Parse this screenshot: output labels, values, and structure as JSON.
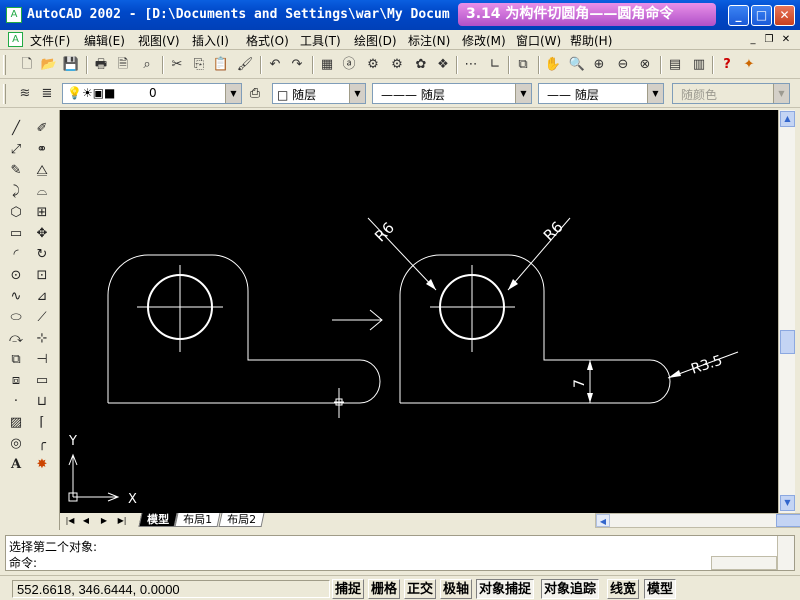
{
  "app": {
    "title": "AutoCAD 2002 - [D:\\Documents and Settings\\war\\My Docum",
    "banner": "3.14 为构件切圆角——圆角命令",
    "min_label": "_",
    "max_label": "□",
    "close_label": "✕"
  },
  "menu": {
    "items": [
      "文件(F)",
      "编辑(E)",
      "视图(V)",
      "插入(I)",
      "格式(O)",
      "工具(T)",
      "绘图(D)",
      "标注(N)",
      "修改(M)",
      "窗口(W)",
      "帮助(H)"
    ],
    "mdi_min": "_",
    "mdi_restore": "❐",
    "mdi_close": "✕"
  },
  "layers": {
    "current_layer": "0",
    "color": "□ 随层",
    "linetype": "——— 随层",
    "lineweight": "—— 随层",
    "plotstyle": "随颜色"
  },
  "drawing": {
    "dims": {
      "r_left": "R6",
      "r_right": "R6",
      "r_small": "R3.5",
      "vertical": "7"
    },
    "ucs": {
      "x_label": "X",
      "y_label": "Y"
    }
  },
  "tabs": {
    "items": [
      "模型",
      "布局1",
      "布局2"
    ],
    "active": "模型"
  },
  "command": {
    "history": "选择第二个对象:",
    "prompt": "命令:"
  },
  "status": {
    "coords": "552.6618, 346.6444, 0.0000",
    "buttons": [
      "捕捉",
      "栅格",
      "正交",
      "极轴",
      "对象捕捉",
      "对象追踪",
      "线宽",
      "模型"
    ]
  },
  "colors": {
    "title_blue": "#0a5fe0",
    "banner_pink": "#d070d8",
    "canvas_bg": "#000000",
    "line_color": "#ffffff"
  }
}
